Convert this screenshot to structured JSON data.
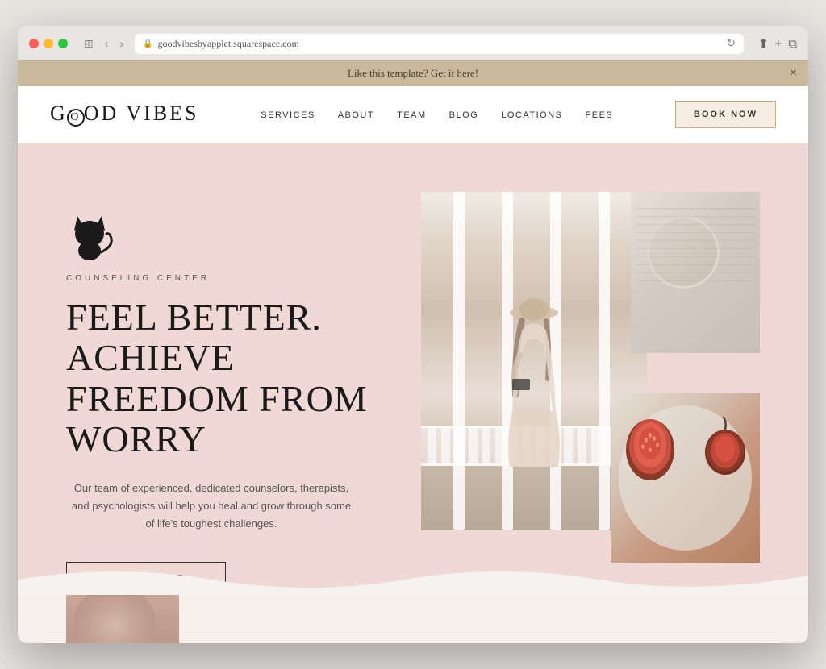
{
  "browser": {
    "url": "goodvibesbyapplet.squarespace.com",
    "back_label": "‹",
    "forward_label": "›",
    "refresh_label": "↻",
    "window_controls_label": "⊞"
  },
  "banner": {
    "text": "Like this template? Get it here!",
    "close_label": "×"
  },
  "nav": {
    "logo": "GOOD VIBES",
    "links": [
      {
        "label": "SERVICES",
        "href": "#"
      },
      {
        "label": "ABOUT",
        "href": "#"
      },
      {
        "label": "TEAM",
        "href": "#"
      },
      {
        "label": "BLOG",
        "href": "#"
      },
      {
        "label": "LOCATIONS",
        "href": "#"
      },
      {
        "label": "FEES",
        "href": "#"
      }
    ],
    "book_button": "BOOK NOW"
  },
  "hero": {
    "subtitle": "COUNSELING CENTER",
    "headline_line1": "FEEL BETTER. ACHIEVE",
    "headline_line2": "FREEDOM FROM WORRY",
    "body": "Our team of experienced, dedicated counselors, therapists, and psychologists will help you heal and grow through some of life's toughest challenges.",
    "cta_button": "LEARN MORE"
  },
  "colors": {
    "hero_bg": "#f0d9d5",
    "banner_bg": "#c9b99a",
    "book_btn_bg": "#f5ede1",
    "book_btn_border": "#c9a87c",
    "headline_color": "#1a1a1a",
    "body_color": "#555555"
  }
}
